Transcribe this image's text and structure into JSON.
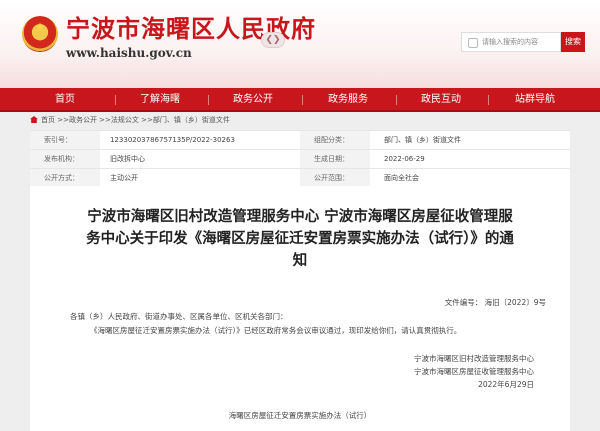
{
  "header": {
    "site_title": "宁波市海曙区人民政府",
    "site_url": "www.haishu.gov.cn",
    "toggle_glyph": "❮❯",
    "search_placeholder": "请输入搜索的内容",
    "search_button": "搜索"
  },
  "nav": [
    "首页",
    "了解海曙",
    "政务公开",
    "政务服务",
    "政民互动",
    "站群导航"
  ],
  "breadcrumb": "首页 >>政务公开 >>法规公文 >>部门、镇（乡）街道文件",
  "meta": {
    "index_label": "索引号：",
    "index_value": "12330203786757135P/2022-30263",
    "category_label": "组配分类：",
    "category_value": "部门、镇（乡）街道文件",
    "issuer_label": "发布机构：",
    "issuer_value": "旧改拆中心",
    "date_label": "生成日期：",
    "date_value": "2022-06-29",
    "mode_label": "公开方式：",
    "mode_value": "主动公开",
    "scope_label": "公开范围：",
    "scope_value": "面向全社会"
  },
  "doc": {
    "title": "宁波市海曙区旧村改造管理服务中心 宁波市海曙区房屋征收管理服务中心关于印发《海曙区房屋征迁安置房票实施办法（试行）》的通知",
    "doc_number": "文件编号：  海旧〔2022〕9号",
    "salutation": "各镇（乡）人民政府、街道办事处、区属各单位、区机关各部门：",
    "body": "《海曙区房屋征迁安置房票实施办法（试行）》已经区政府常务会议审议通过，现印发给你们，请认真贯彻执行。",
    "signer1": "宁波市海曙区旧村改造管理服务中心",
    "signer2": "宁波市海曙区房屋征收管理服务中心",
    "sign_date": "2022年6月29日",
    "attachment_title": "海曙区房屋征迁安置房票实施办法（试行）"
  }
}
